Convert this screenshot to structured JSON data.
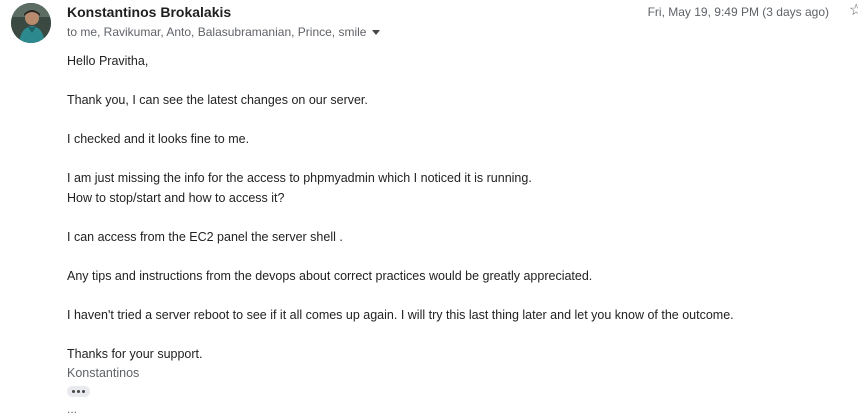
{
  "header": {
    "sender_name": "Konstantinos Brokalakis",
    "recipients": "to me, Ravikumar, Anto, Balasubramanian, Prince, smile",
    "date": "Fri, May 19, 9:49 PM (3 days ago)",
    "star_icon": "star-icon",
    "expand_icon": "chevron-down-icon"
  },
  "body": {
    "greeting": "Hello Pravitha,",
    "line1": "Thank you, I can see the latest changes on our server.",
    "line2": "I checked and it looks fine to me.",
    "line3": "I am just missing the info for the access to phpmyadmin which I noticed it is running.",
    "line4": "How to stop/start and how to access it?",
    "line5": "I can access from the EC2 panel the server shell .",
    "line6": "Any tips and instructions from the devops about correct practices would be greatly appreciated.",
    "line7": "I haven't tried a server reboot to see if it all comes up again. I will try this last thing later and let you know of the outcome.",
    "closing": "Thanks for your support.",
    "signature": "Konstantinos"
  },
  "footer": {
    "show_trimmed_icon": "more-horizontal-icon",
    "trailing_text": "..."
  }
}
